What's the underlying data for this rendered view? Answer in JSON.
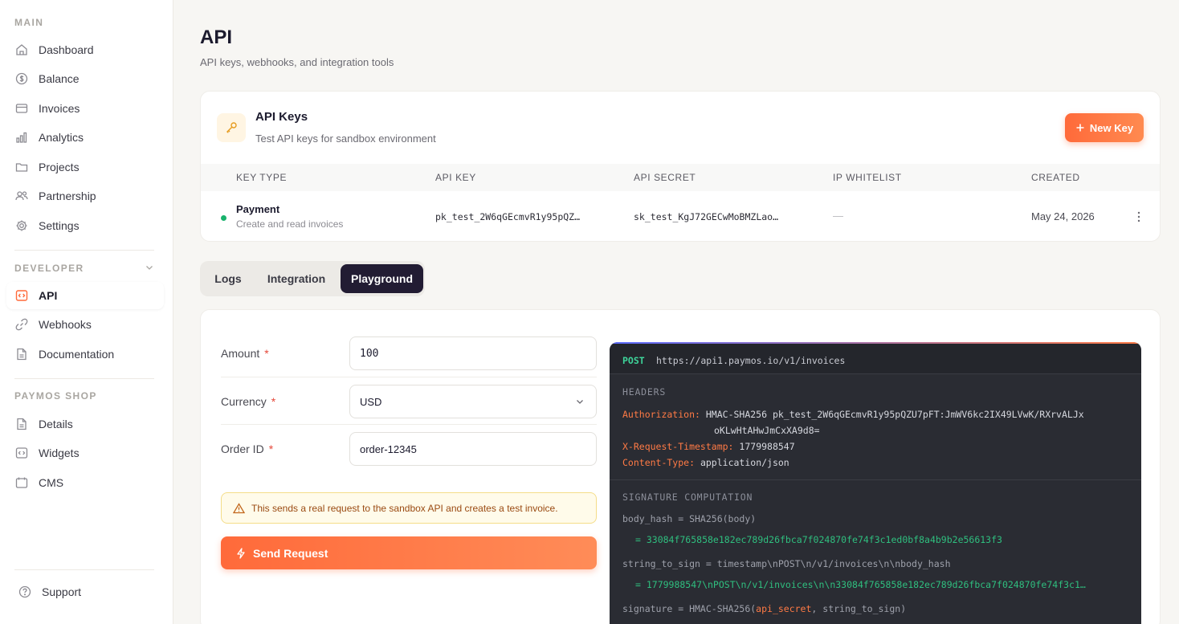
{
  "sidebar": {
    "main_title": "MAIN",
    "main_items": [
      {
        "label": "Dashboard",
        "icon": "home-icon"
      },
      {
        "label": "Balance",
        "icon": "dollar-icon"
      },
      {
        "label": "Invoices",
        "icon": "card-icon"
      },
      {
        "label": "Analytics",
        "icon": "bar-chart-icon"
      },
      {
        "label": "Projects",
        "icon": "folder-icon"
      },
      {
        "label": "Partnership",
        "icon": "users-icon"
      },
      {
        "label": "Settings",
        "icon": "gear-icon"
      }
    ],
    "developer_title": "DEVELOPER",
    "developer_items": [
      {
        "label": "API",
        "icon": "code-icon"
      },
      {
        "label": "Webhooks",
        "icon": "link-icon"
      },
      {
        "label": "Documentation",
        "icon": "document-icon"
      }
    ],
    "shop_title": "PAYMOS SHOP",
    "shop_items": [
      {
        "label": "Details",
        "icon": "document-icon"
      },
      {
        "label": "Widgets",
        "icon": "code-box-icon"
      },
      {
        "label": "CMS",
        "icon": "cms-icon"
      }
    ],
    "support_label": "Support"
  },
  "header": {
    "title": "API",
    "subtitle": "API keys, webhooks, and integration tools"
  },
  "api_keys": {
    "title": "API Keys",
    "subtitle": "Test API keys for sandbox environment",
    "new_key_label": "New Key",
    "columns": [
      "KEY TYPE",
      "API KEY",
      "API SECRET",
      "IP WHITELIST",
      "CREATED"
    ],
    "rows": [
      {
        "type": "Payment",
        "type_desc": "Create and read invoices",
        "api_key": "pk_test_2W6qGEcmvR1y95pQZ…",
        "api_secret": "sk_test_KgJ72GECwMoBMZLao…",
        "ip_whitelist": "—",
        "created": "May 24, 2026",
        "status_color": "#18b26c"
      }
    ]
  },
  "tabs": [
    "Logs",
    "Integration",
    "Playground"
  ],
  "active_tab": "Playground",
  "form": {
    "amount_label": "Amount",
    "amount_value": "100",
    "currency_label": "Currency",
    "currency_value": "USD",
    "order_label": "Order ID",
    "order_value": "order-12345",
    "required_mark": "*",
    "warning": "This sends a real request to the sandbox API and creates a test invoice.",
    "send_label": "Send Request"
  },
  "request": {
    "method": "POST",
    "url": "https://api1.paymos.io/v1/invoices",
    "headers_title": "HEADERS",
    "auth_key": "Authorization:",
    "auth_value_1": "HMAC-SHA256 pk_test_2W6qGEcmvR1y95pQZU7pFT:JmWV6kc2IX49LVwK/RXrvALJx",
    "auth_value_2": "oKLwHtAHwJmCxXA9d8=",
    "ts_key": "X-Request-Timestamp:",
    "ts_value": "1779988547",
    "ct_key": "Content-Type:",
    "ct_value": "application/json",
    "sig_title": "SIGNATURE COMPUTATION",
    "body_hash_line": "body_hash = SHA256(body)",
    "body_hash_value": "= 33084f765858e182ec789d26fbca7f024870fe74f3c1ed0bf8a4b9b2e56613f3",
    "sts_line": "string_to_sign = timestamp\\nPOST\\n/v1/invoices\\n\\nbody_hash",
    "sts_value": "= 1779988547\\nPOST\\n/v1/invoices\\n\\n33084f765858e182ec789d26fbca7f024870fe74f3c1…",
    "signature_prefix": "signature = HMAC-SHA256(",
    "signature_arg": "api_secret",
    "signature_suffix": ", string_to_sign)"
  },
  "colors": {
    "accent": "#ff6a3a",
    "active_tab_bg": "#221c33",
    "success": "#18b26c",
    "code_bg": "#2a2c33"
  }
}
